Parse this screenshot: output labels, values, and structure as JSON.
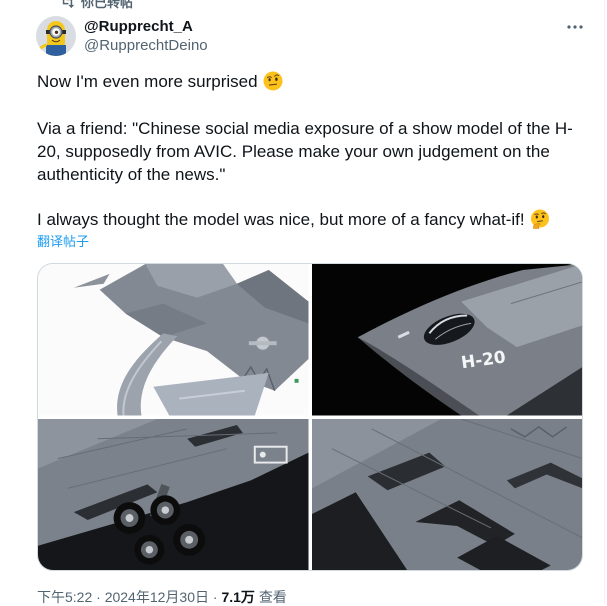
{
  "retweet_banner": {
    "icon": "retweet-icon",
    "label": "你已转帖"
  },
  "author": {
    "avatar_icon": "minion-avatar",
    "display_name": "@Rupprecht_A",
    "handle": "@RupprechtDeino"
  },
  "more_options_icon": "more-options-icon",
  "tweet": {
    "line_1": "Now I'm even more surprised",
    "line_1_emoji": "face-with-raised-eyebrow-emoji",
    "line_2": "Via a friend: \"Chinese social media exposure of a show model of the H-",
    "line_3": "20, supposedly from AVIC. Please make your own judgement on the",
    "line_4": "authenticity of the news.\"",
    "line_5": "I always thought the model was nice, but more of a fancy what-if!",
    "line_5_emoji": "thinking-face-emoji",
    "translate_link": "翻译帖子"
  },
  "media": {
    "photo_2_marking": "H-20"
  },
  "footer": {
    "time": "下午5:22",
    "separator": "·",
    "date": "2024年12月30日",
    "views": "7.1万",
    "views_label": "查看"
  },
  "colors": {
    "text_primary": "#0f1419",
    "text_secondary": "#536471",
    "link": "#1d9bf0",
    "border": "#cfd9de"
  }
}
